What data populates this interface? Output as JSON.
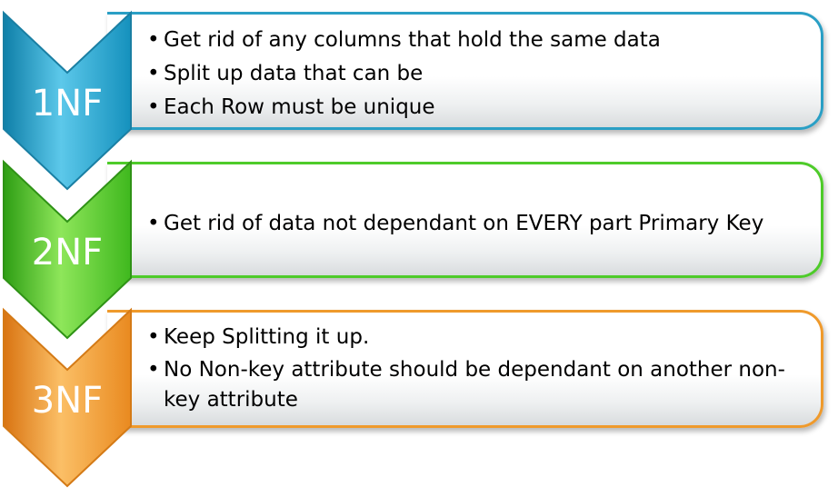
{
  "steps": [
    {
      "label": "1NF",
      "color": "#1fa0cc",
      "bullets": [
        "Get rid of any columns that hold the same data",
        "Split up data that can be",
        "Each Row must be unique"
      ]
    },
    {
      "label": "2NF",
      "color": "#47c72a",
      "bullets": [
        "Get rid of data not dependant on  EVERY part Primary Key"
      ]
    },
    {
      "label": "3NF",
      "color": "#f29a2e",
      "bullets": [
        "Keep Splitting it up.",
        "No Non-key attribute should be dependant on another non-key attribute"
      ]
    }
  ]
}
